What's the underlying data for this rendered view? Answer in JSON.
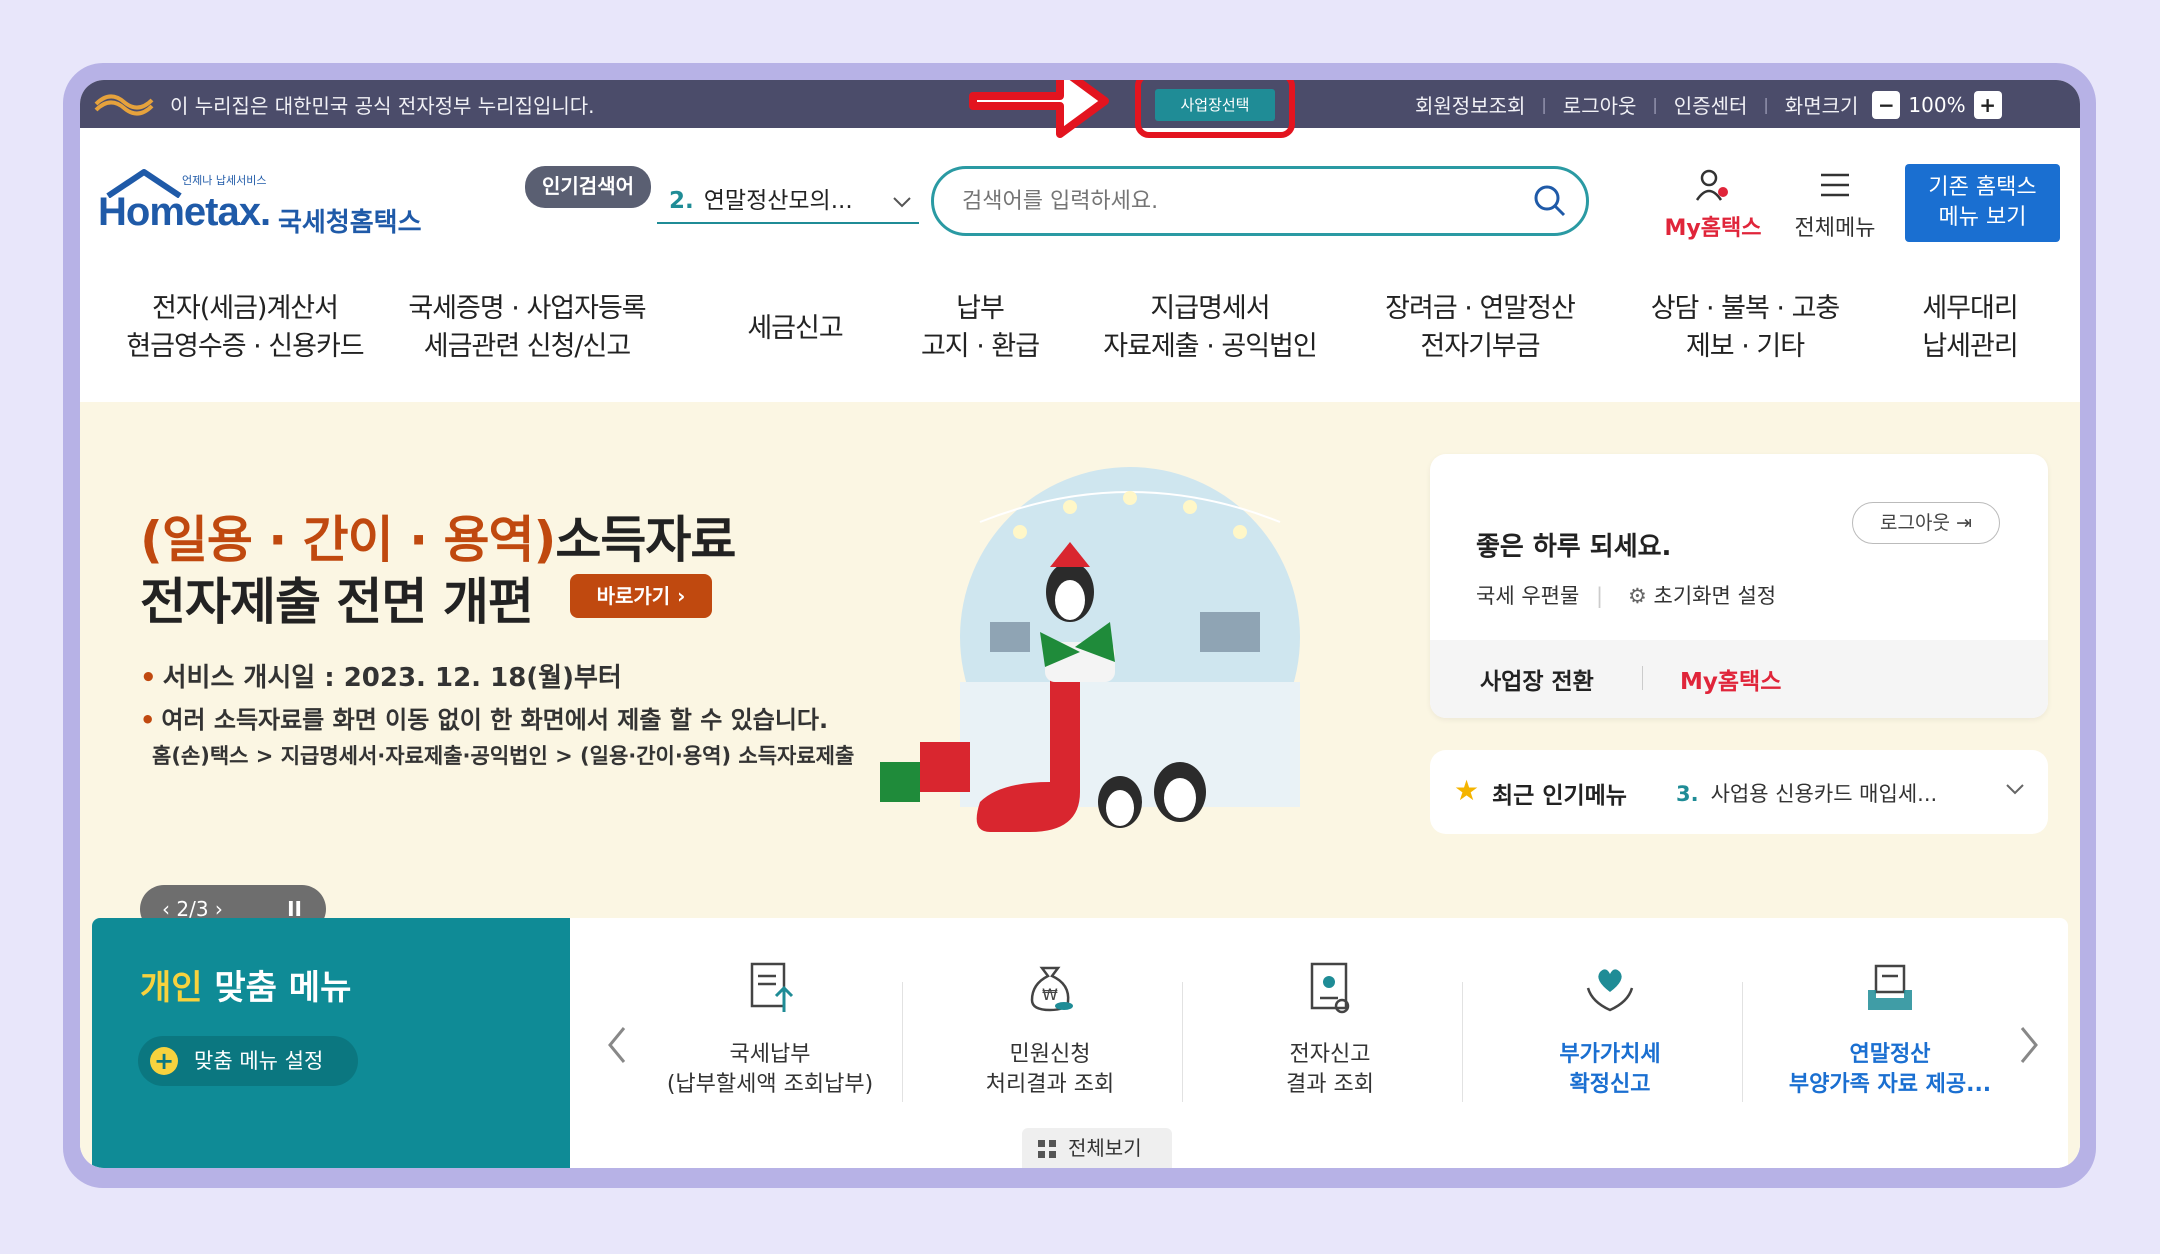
{
  "govbar": {
    "notice": "이 누리집은 대한민국 공식 전자정부 누리집입니다.",
    "biz_select": "사업장선택",
    "links": [
      "회원정보조회",
      "로그아웃",
      "인증센터",
      "화면크기"
    ],
    "zoom_minus": "−",
    "zoom_value": "100%",
    "zoom_plus": "+"
  },
  "header": {
    "logo_small": "언제나 납세서비스",
    "logo_main": "Hometax.",
    "logo_sub": "국세청홈택스",
    "popular_badge": "인기검색어",
    "popular_num": "2.",
    "popular_text": "연말정산모의...",
    "search_placeholder": "검색어를 입력하세요.",
    "my_hometax": "My홈택스",
    "all_menu": "전체메뉴",
    "legacy_line1": "기존 홈택스",
    "legacy_line2": "메뉴 보기"
  },
  "nav": [
    {
      "l1": "전자(세금)계산서",
      "l2": "현금영수증 · 신용카드"
    },
    {
      "l1": "국세증명 · 사업자등록",
      "l2": "세금관련 신청/신고"
    },
    {
      "l1": "세금신고",
      "l2": ""
    },
    {
      "l1": "납부",
      "l2": "고지 · 환급"
    },
    {
      "l1": "지급명세서",
      "l2": "자료제출 · 공익법인"
    },
    {
      "l1": "장려금 · 연말정산",
      "l2": "전자기부금"
    },
    {
      "l1": "상담 · 불복 · 고충",
      "l2": "제보 · 기타"
    },
    {
      "l1": "세무대리",
      "l2": "납세관리"
    }
  ],
  "banner": {
    "title_hl": "(일용 · 간이 · 용역)",
    "title_rest": "소득자료",
    "title2": "전자제출 전면 개편",
    "go_button": "바로가기 ›",
    "line1": "서비스 개시일 : 2023. 12. 18(월)부터",
    "line2": "여러 소득자료를 화면 이동 없이 한 화면에서 제출 할 수 있습니다.",
    "line3": "홈(손)택스 > 지급명세서·자료제출·공익법인 > (일용·간이·용역) 소득자료제출",
    "pager": "‹  2/3  ›",
    "pause": "II"
  },
  "login_card": {
    "greeting": "좋은 하루 되세요.",
    "logout": "로그아웃",
    "post": "국세 우편물",
    "init_setting": "초기화면 설정",
    "biz_switch": "사업장 전환",
    "my_hometax": "My홈택스"
  },
  "recent": {
    "label": "최근 인기메뉴",
    "num": "3.",
    "item": "사업용 신용카드 매입세..."
  },
  "personal_menu": {
    "title_y": "개인",
    "title_rest": " 맞춤 메뉴",
    "setting": "맞춤 메뉴 설정",
    "items": [
      {
        "t1": "국세납부",
        "t2": "(납부할세액 조회납부)",
        "icon": "tax-payment-icon"
      },
      {
        "t1": "민원신청",
        "t2": "처리결과 조회",
        "icon": "money-bag-icon"
      },
      {
        "t1": "전자신고",
        "t2": "결과 조회",
        "icon": "certificate-icon"
      },
      {
        "t1": "부가가치세",
        "t2": "확정신고",
        "icon": "heart-hands-icon"
      },
      {
        "t1": "연말정산",
        "t2": "부양가족 자료 제공...",
        "icon": "document-tray-icon"
      }
    ],
    "view_all": "전체보기"
  },
  "colors": {
    "teal": "#0f8b96",
    "red_highlight": "#e3141f",
    "brand_blue": "#1a6fd1",
    "accent_orange": "#c0490f"
  }
}
